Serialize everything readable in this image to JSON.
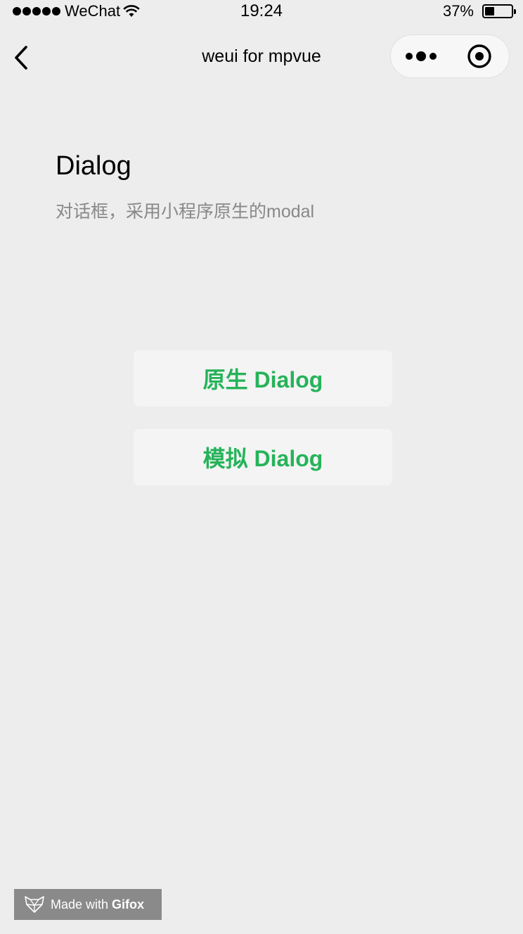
{
  "status_bar": {
    "carrier": "WeChat",
    "time": "19:24",
    "battery_percent": "37%",
    "battery_level": 0.37,
    "signal_bars": 5
  },
  "nav": {
    "title": "weui for mpvue",
    "back_icon": "chevron-left-icon",
    "more_icon": "more-dots-icon",
    "close_icon": "target-circle-icon"
  },
  "page": {
    "title": "Dialog",
    "description": "对话框，采用小程序原生的modal"
  },
  "buttons": {
    "native_dialog": "原生 Dialog",
    "mock_dialog": "模拟 Dialog"
  },
  "watermark": {
    "made_with": "Made with",
    "brand": "Gifox",
    "logo_icon": "fox-logo-icon"
  },
  "colors": {
    "background": "#ededed",
    "button_bg": "#f4f4f4",
    "accent_green": "#26b35a",
    "description_gray": "#888888",
    "watermark_bg": "#8a8a8a"
  }
}
